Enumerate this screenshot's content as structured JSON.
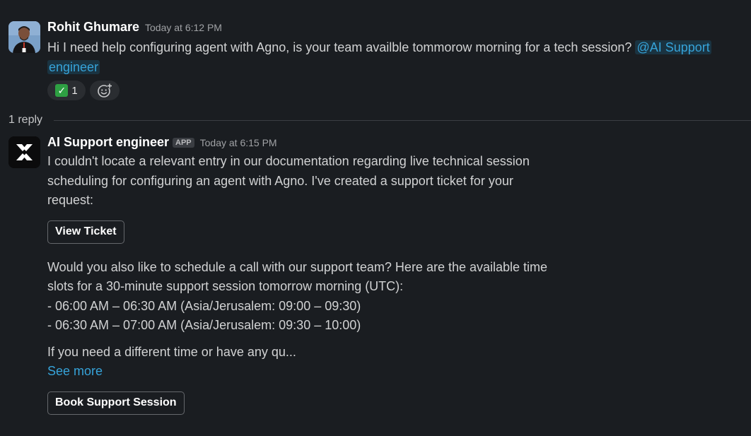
{
  "messages": [
    {
      "sender": "Rohit Ghumare",
      "timestamp": "Today at 6:12 PM",
      "text": "Hi I need help configuring agent with Agno, is your team availble tommorow morning for a tech session?",
      "mention": "@AI Support engineer",
      "mention_line1": "@AI Support",
      "mention_line2": "engineer",
      "reaction": {
        "emoji": "✅",
        "count": "1",
        "icon": "white-check-mark"
      },
      "add_reaction_icon": "add-reaction-icon"
    },
    {
      "sender": "AI Support engineer",
      "badge": "APP",
      "timestamp": "Today at 6:15 PM",
      "paragraph1": [
        "I couldn't locate a relevant entry in our documentation regarding live technical session",
        "scheduling for configuring an agent with Agno. I've created a support ticket for your",
        "request:"
      ],
      "ticket_button": "View Ticket",
      "paragraph2": [
        "Would you also like to schedule a call with our support team? Here are the available time",
        "slots for a 30-minute support session tomorrow morning (UTC):",
        "- 06:00 AM – 06:30 AM (Asia/Jerusalem: 09:00 – 09:30)",
        "- 06:30 AM – 07:00 AM (Asia/Jerusalem: 09:30 – 10:00)"
      ],
      "truncated": "If you need a different time or have any qu...",
      "see_more": "See more",
      "session_button": "Book Support Session"
    }
  ],
  "thread": {
    "reply_count": "1 reply"
  },
  "colors": {
    "background": "#1a1d21",
    "link": "#36a3d9",
    "text": "#d1d2d3"
  }
}
